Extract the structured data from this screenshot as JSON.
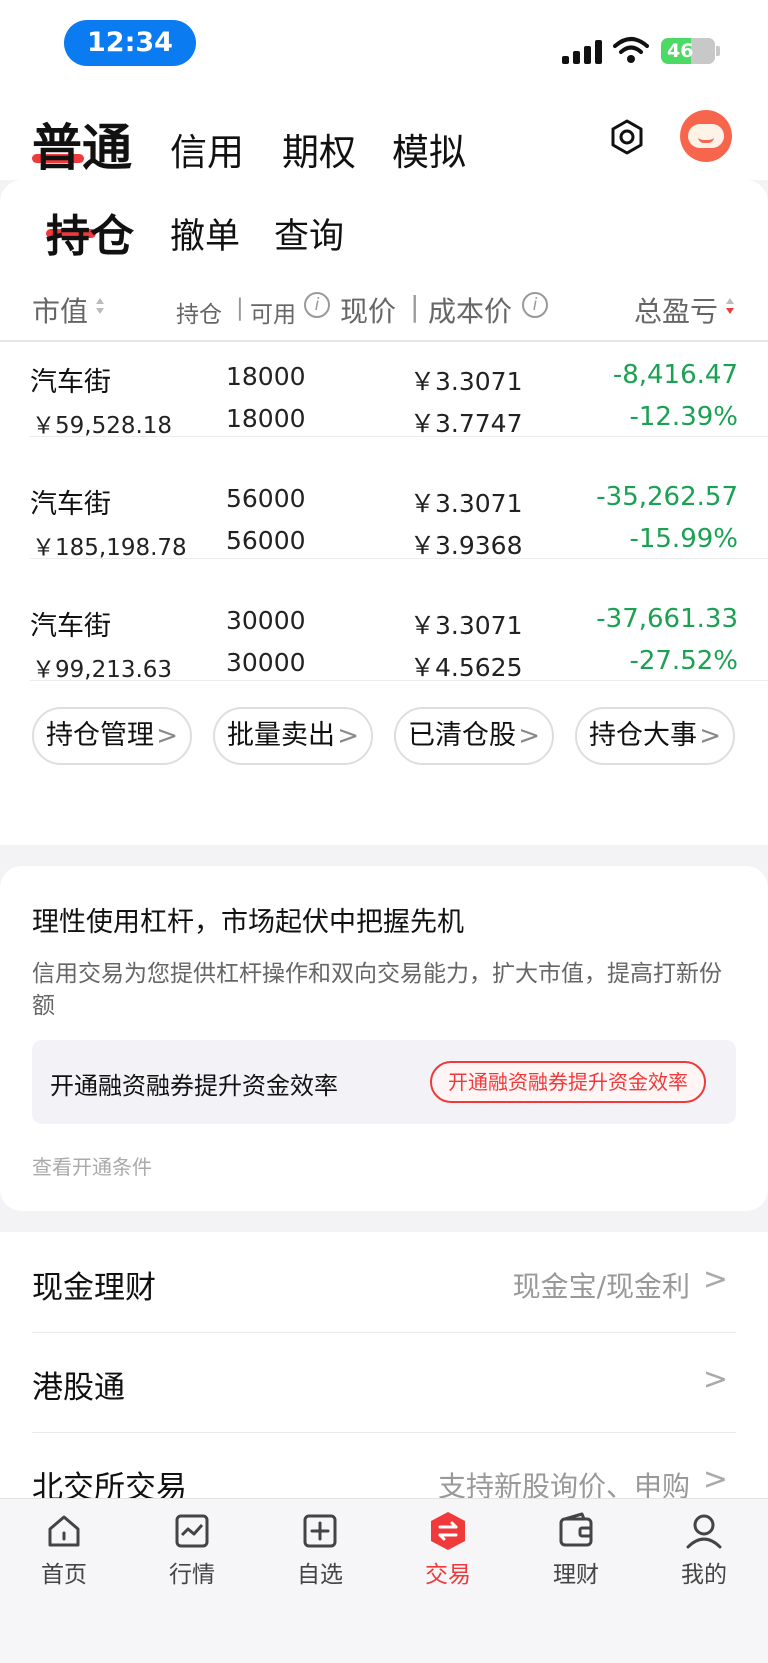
{
  "status": {
    "time": "12:34",
    "battery": "46"
  },
  "top_tabs": [
    "普通",
    "信用",
    "期权",
    "模拟"
  ],
  "sub_tabs": [
    "持仓",
    "撤单",
    "查询"
  ],
  "table_header": {
    "market_value": "市值",
    "holding": "持仓",
    "available": "可用",
    "current_price": "现价",
    "cost_price": "成本价",
    "total_pl": "总盈亏"
  },
  "holdings": [
    {
      "name": "汽车街",
      "market_value": "￥59,528.18",
      "holding": "18000",
      "available": "18000",
      "current_price": "￥3.3071",
      "cost_price": "￥3.7747",
      "pl": "-8,416.47",
      "pl_pct": "-12.39%"
    },
    {
      "name": "汽车街",
      "market_value": "￥185,198.78",
      "holding": "56000",
      "available": "56000",
      "current_price": "￥3.3071",
      "cost_price": "￥3.9368",
      "pl": "-35,262.57",
      "pl_pct": "-15.99%"
    },
    {
      "name": "汽车街",
      "market_value": "￥99,213.63",
      "holding": "30000",
      "available": "30000",
      "current_price": "￥3.3071",
      "cost_price": "￥4.5625",
      "pl": "-37,661.33",
      "pl_pct": "-27.52%"
    }
  ],
  "actions": [
    "持仓管理",
    "批量卖出",
    "已清仓股",
    "持仓大事"
  ],
  "credit": {
    "title": "理性使用杠杆，市场起伏中把握先机",
    "desc": "信用交易为您提供杠杆操作和双向交易能力，扩大市值，提高打新份额",
    "box_label": "开通融资融券提升资金效率",
    "button": "开通融资融券提升资金效率",
    "link": "查看开通条件"
  },
  "menu": [
    {
      "label": "现金理财",
      "value": "现金宝/现金利"
    },
    {
      "label": "港股通",
      "value": ""
    },
    {
      "label": "北交所交易",
      "value": "支持新股询价、申购"
    }
  ],
  "bottom_nav": [
    "首页",
    "行情",
    "自选",
    "交易",
    "理财",
    "我的"
  ],
  "colors": {
    "accent": "#f0393a",
    "loss_green": "#1aa152",
    "status_blue": "#0a7bf0"
  }
}
